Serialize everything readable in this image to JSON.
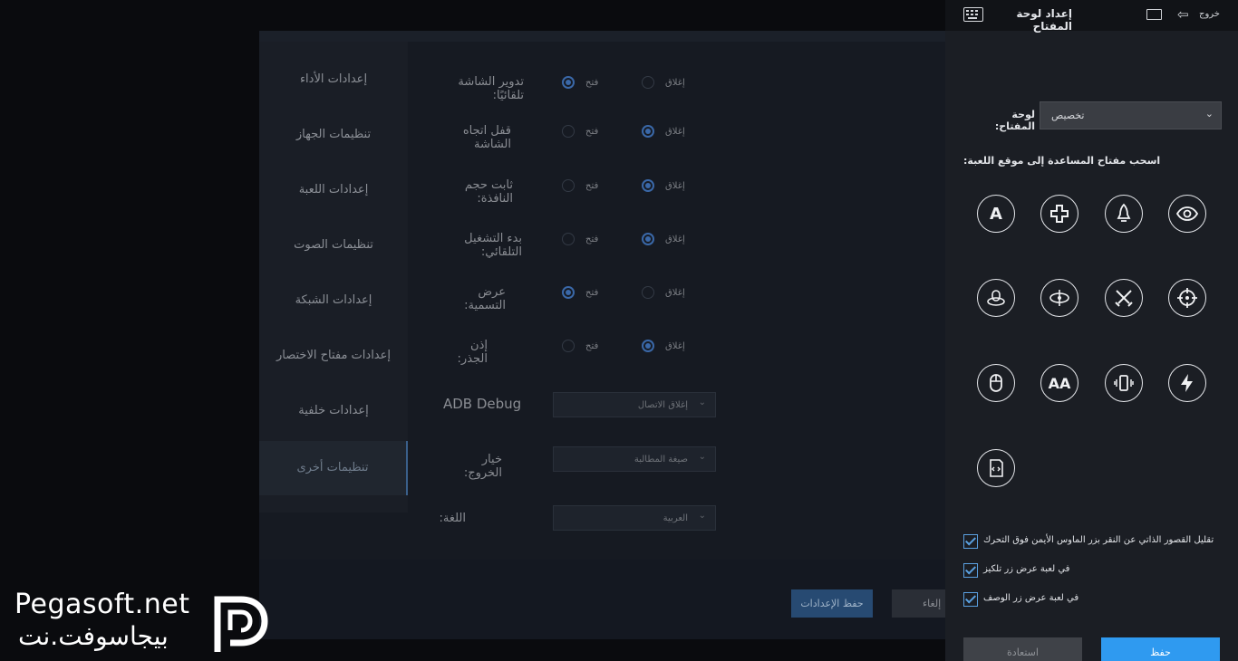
{
  "dialog": {
    "nav": [
      {
        "label": "إعدادات الأداء",
        "active": false
      },
      {
        "label": "تنظيمات الجهاز",
        "active": false
      },
      {
        "label": "إعدادات اللعبة",
        "active": false
      },
      {
        "label": "تنظيمات الصوت",
        "active": false
      },
      {
        "label": "إعدادات الشبكة",
        "active": false
      },
      {
        "label": "إعدادات مفتاح الاختصار",
        "active": false
      },
      {
        "label": "إعدادات خلفية",
        "active": false
      },
      {
        "label": "تنظيمات أخرى",
        "active": true
      }
    ],
    "options": [
      {
        "label": "تدوير الشاشة تلقائيًا:",
        "on_label": "فتح",
        "off_label": "إغلاق",
        "selected": "on"
      },
      {
        "label": "قفل اتجاه الشاشة",
        "on_label": "فتح",
        "off_label": "إغلاق",
        "selected": "off"
      },
      {
        "label": "ثابت حجم النافذة:",
        "on_label": "فتح",
        "off_label": "إغلاق",
        "selected": "off"
      },
      {
        "label": "بدء التشغيل التلقائي:",
        "on_label": "فتح",
        "off_label": "إغلاق",
        "selected": "off"
      },
      {
        "label": "عرض التسمية:",
        "on_label": "فتح",
        "off_label": "إغلاق",
        "selected": "on"
      },
      {
        "label": "إذن الجذر:",
        "on_label": "فتح",
        "off_label": "إغلاق",
        "selected": "off"
      }
    ],
    "adb_label": "ADB Debug",
    "adb_value": "إغلاق الاتصال",
    "exit_label": "خيار الخروج:",
    "exit_value": "صيغة المطالبة",
    "lang_label": "اللغة:",
    "lang_value": "العربية",
    "save_settings": "حفظ الإعدادات",
    "cancel": "إلغاء"
  },
  "panel": {
    "title": "إعداد لوحة المفتاح",
    "exit_label": "خروج",
    "keyboard_label": "لوحة المفتاح:",
    "keyboard_value": "تخصيص",
    "drag_hint": "اسحب مفتاح المساعدة إلى موقع اللعبة:",
    "icons": [
      "letter-a-icon",
      "dpad-icon",
      "rocket-icon",
      "eye-icon",
      "mouse-circle-icon",
      "rotate-icon",
      "crossed-swords-icon",
      "crosshair-icon",
      "mouse-icon",
      "double-a-icon",
      "shake-phone-icon",
      "lightning-icon",
      "script-icon"
    ],
    "icon_text": {
      "a": "A",
      "aa": "AA"
    },
    "checkboxes": [
      {
        "label": "تقليل القصور الذاتي عن النقر بزر الماوس الأيمن فوق التحرك",
        "checked": true
      },
      {
        "label": "في لعبة عرض زر تلكيز",
        "checked": true
      },
      {
        "label": "في لعبة عرض زر الوصف",
        "checked": true
      }
    ],
    "restore_label": "استعادة",
    "save_label": "حفظ"
  },
  "watermark": {
    "latin": "Pegasoft.net",
    "arabic": "بيجاسوفت.نت"
  },
  "colors": {
    "accent": "#2f9af0",
    "panel_bg": "#1b1e24",
    "dim_bg": "#161a22"
  }
}
